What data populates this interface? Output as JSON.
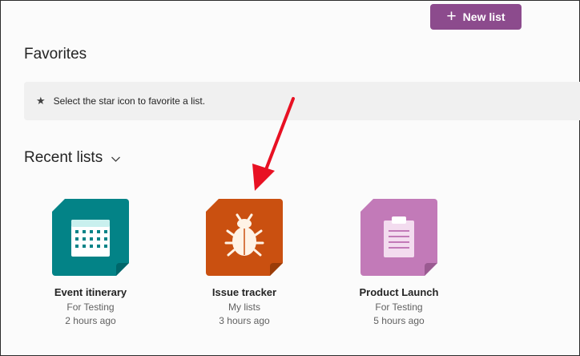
{
  "toolbar": {
    "new_list_label": "New list"
  },
  "favorites": {
    "title": "Favorites",
    "hint": "Select the star icon to favorite a list."
  },
  "recent": {
    "title": "Recent lists",
    "items": [
      {
        "name": "Event itinerary",
        "location": "For Testing",
        "modified": "2 hours ago",
        "icon": "calendar-icon",
        "color": "#038387"
      },
      {
        "name": "Issue tracker",
        "location": "My lists",
        "modified": "3 hours ago",
        "icon": "bug-icon",
        "color": "#ca5010"
      },
      {
        "name": "Product Launch",
        "location": "For Testing",
        "modified": "5 hours ago",
        "icon": "clipboard-icon",
        "color": "#c27ab8"
      }
    ]
  },
  "colors": {
    "accent": "#8c4b8d",
    "annotation_arrow": "#e81123",
    "banner_bg": "#f0f0f0"
  }
}
